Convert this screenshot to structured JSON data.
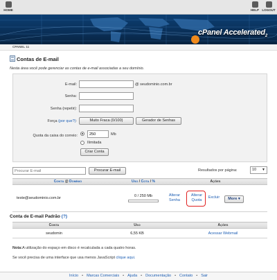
{
  "topbar": {
    "home": "HOME",
    "help": "HELP",
    "logout": "LOGOUT"
  },
  "brand": {
    "name": "cPanel Accelerated",
    "version": "2"
  },
  "breadcrumb": "CPANEL 11",
  "page": {
    "title": "Contas de E-mail",
    "intro": "Nesta área você pode gerenciar as contas de e-mail associadas a seu domínio."
  },
  "form": {
    "email_label": "E-mail:",
    "domain_suffix": "@ seudominio.com.br",
    "password_label": "Senha:",
    "password_repeat_label": "Senha (repetir):",
    "strength_label": "Força",
    "strength_why": "(por que?)",
    "strength_colon": ":",
    "strength_value": "Muito Fraca (0/100)",
    "generator_button": "Gerador de Senhas",
    "quota_label": "Quota da caixa do correio:",
    "quota_value": "250",
    "quota_unit": "Mb",
    "unlimited_label": "Ilimitada",
    "create_button": "Criar Conta"
  },
  "search": {
    "placeholder": "Procurar E-mail",
    "button": "Procurar E-mail",
    "per_page_label": "Resultados por página:",
    "per_page_value": "10"
  },
  "accounts_table": {
    "header_account": "Conta",
    "header_at": "@",
    "header_domain": "Domínio",
    "header_use": "Uso",
    "header_sep1": "/",
    "header_quota": "Cota",
    "header_sep2": "/",
    "header_pct": "%",
    "header_actions": "Ações",
    "rows": [
      {
        "account": "teste@seudominio.com.br",
        "usage": "0 / 250 Mb",
        "usage_fraction": 0,
        "change_password": "Alterar Senha",
        "change_quota": "Alterar Quota",
        "delete": "Excluir",
        "more": "More ▾"
      }
    ]
  },
  "default_account": {
    "title": "Conta de E-mail Padrão",
    "help": "(?)",
    "header_account": "Conta",
    "header_use": "Uso",
    "header_actions": "Ações",
    "rows": [
      {
        "account": "seudomin",
        "usage": "6,55 KB",
        "action": "Acessar Webmail"
      }
    ]
  },
  "notes": {
    "note_label": "Nota:",
    "note_text": "A utilização do espaço em disco é recalculada a cada quatro horas.",
    "js_text": "Se você precisa de uma interface que usa menos JavaScript",
    "js_link": "clique aqui."
  },
  "footer": {
    "links": [
      "Início",
      "Marcas Comerciais",
      "Ajuda",
      "Documentação",
      "Contato",
      "Sair"
    ]
  },
  "colors": {
    "link": "#1e5fb4",
    "banner": "#0c3f73",
    "highlight": "#e02020"
  }
}
